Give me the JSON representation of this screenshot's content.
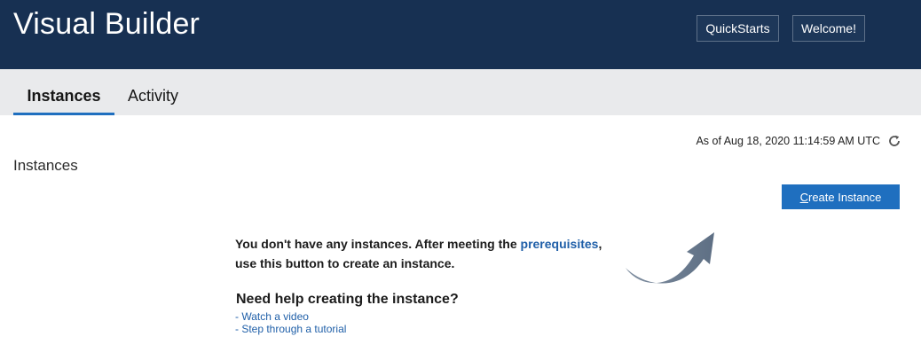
{
  "header": {
    "title": "Visual Builder",
    "quickstarts_label": "QuickStarts",
    "welcome_label": "Welcome!"
  },
  "tabs": [
    {
      "label": "Instances",
      "active": true
    },
    {
      "label": "Activity",
      "active": false
    }
  ],
  "status": {
    "timestamp": "As of Aug 18, 2020 11:14:59 AM UTC"
  },
  "main": {
    "section_title": "Instances",
    "create_button_prefix": "C",
    "create_button_rest": "reate Instance",
    "empty_text_1": "You don't have any instances. After meeting the ",
    "prerequisites_link": "prerequisites",
    "empty_text_2": ",",
    "empty_text_3": "use this button to create an instance.",
    "help_title": "Need help creating the instance?",
    "help_link_video": "- Watch a video",
    "help_link_tutorial": "- Step through a tutorial"
  },
  "colors": {
    "header_bg": "#173052",
    "accent": "#1f6fbf",
    "link": "#1f5fa8",
    "tabbar_bg": "#e9eaec"
  }
}
